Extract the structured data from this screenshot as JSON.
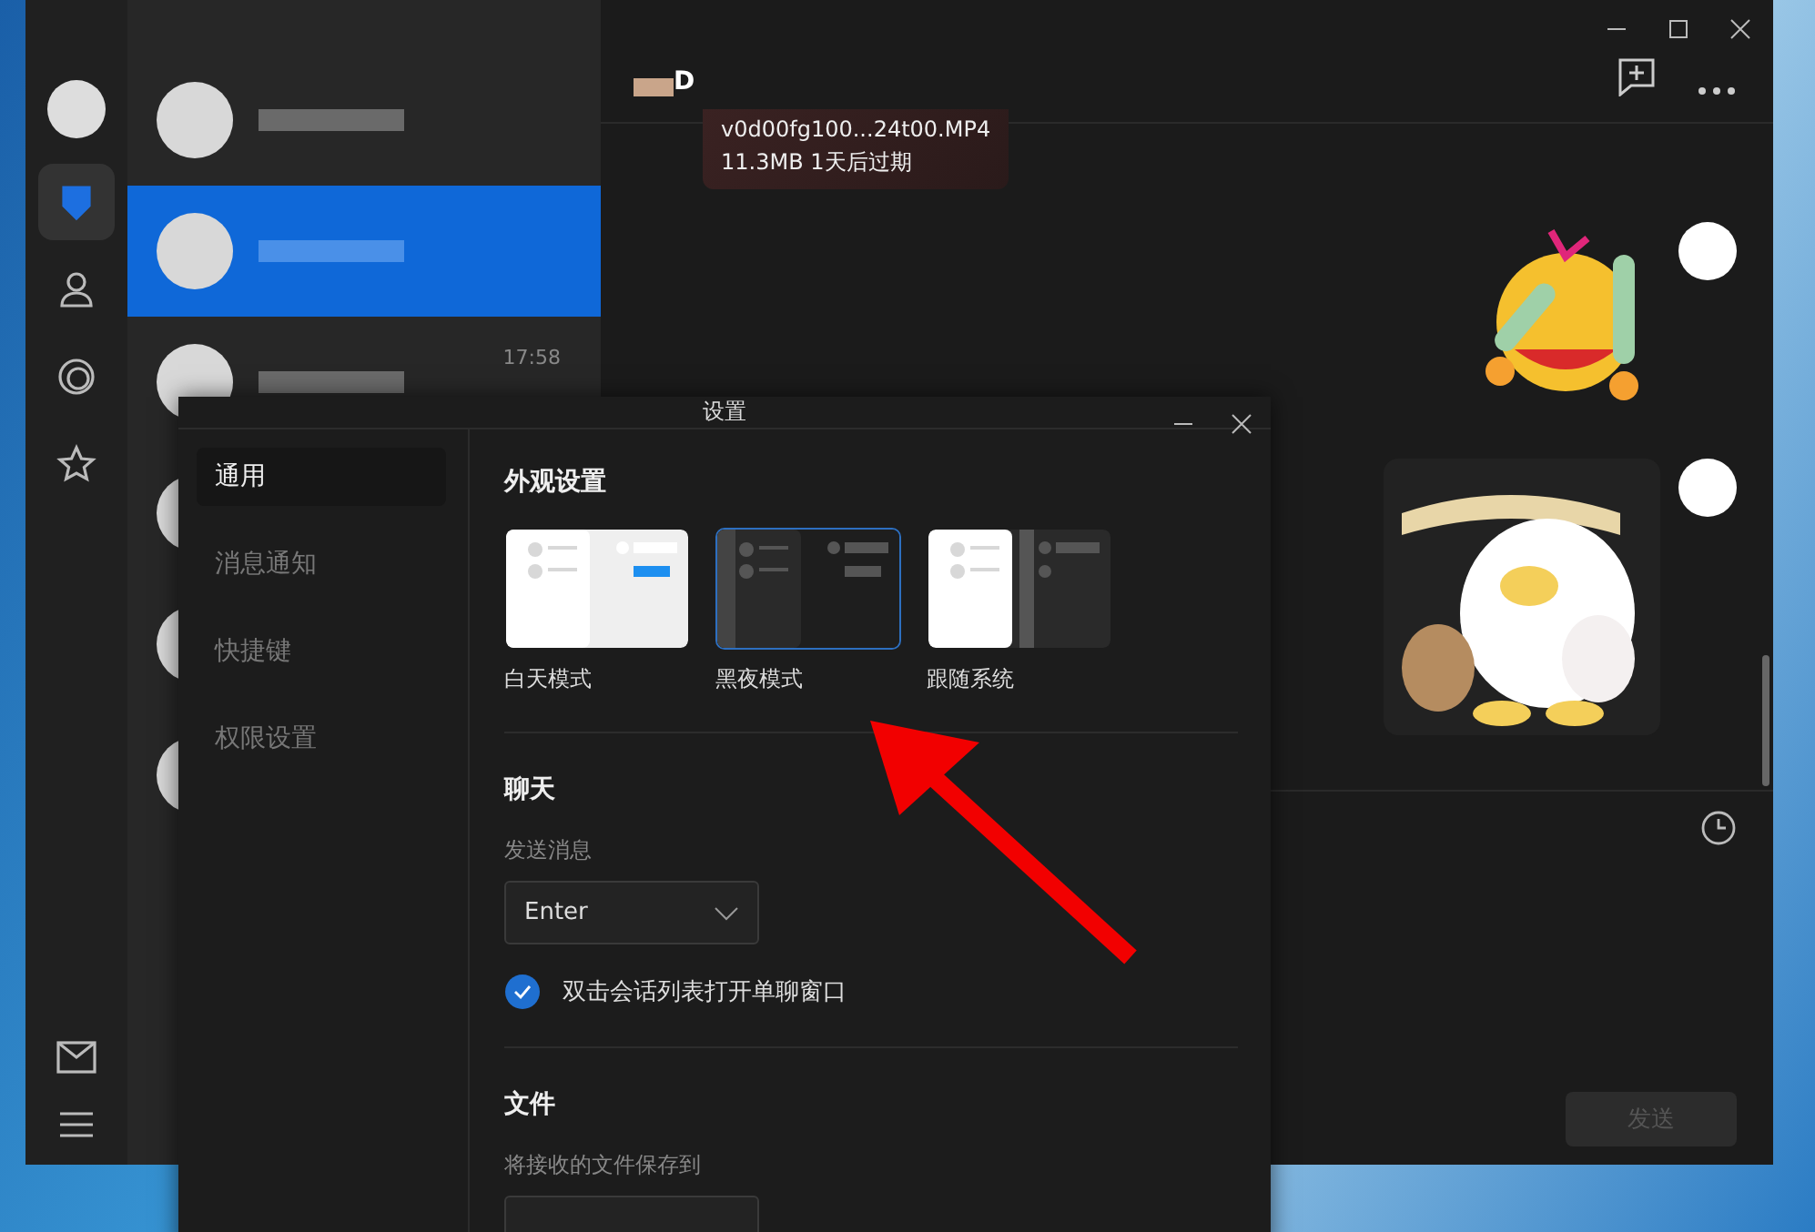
{
  "rail": {
    "items": [
      {
        "kind": "chat",
        "selected": true
      },
      {
        "kind": "contacts",
        "selected": false
      },
      {
        "kind": "moments",
        "selected": false
      },
      {
        "kind": "favorites",
        "selected": false
      }
    ],
    "bottom": [
      {
        "kind": "mail"
      },
      {
        "kind": "menu"
      }
    ]
  },
  "conversations": [
    {
      "selected": false
    },
    {
      "selected": true
    },
    {
      "selected": false,
      "time": "17:58"
    },
    {
      "selected": false
    },
    {
      "selected": false
    },
    {
      "selected": false
    }
  ],
  "chat": {
    "contact_suffix": "D",
    "file_message": {
      "name": "v0d00fg100...24t00.MP4",
      "info": "11.3MB  1天后过期"
    },
    "send_button": {
      "label": "发送",
      "disabled": true
    }
  },
  "settings": {
    "title": "设置",
    "nav": [
      {
        "label": "通用",
        "selected": true
      },
      {
        "label": "消息通知",
        "selected": false
      },
      {
        "label": "快捷键",
        "selected": false
      },
      {
        "label": "权限设置",
        "selected": false
      }
    ],
    "appearance": {
      "heading": "外观设置",
      "themes": [
        {
          "label": "白天模式",
          "kind": "light",
          "selected": false
        },
        {
          "label": "黑夜模式",
          "kind": "dark",
          "selected": true
        },
        {
          "label": "跟随系统",
          "kind": "system",
          "selected": false
        }
      ]
    },
    "chat": {
      "heading": "聊天",
      "send_label": "发送消息",
      "send_value": "Enter",
      "double_click": {
        "label": "双击会话列表打开单聊窗口",
        "checked": true
      }
    },
    "files": {
      "heading": "文件",
      "save_label": "将接收的文件保存到"
    }
  }
}
